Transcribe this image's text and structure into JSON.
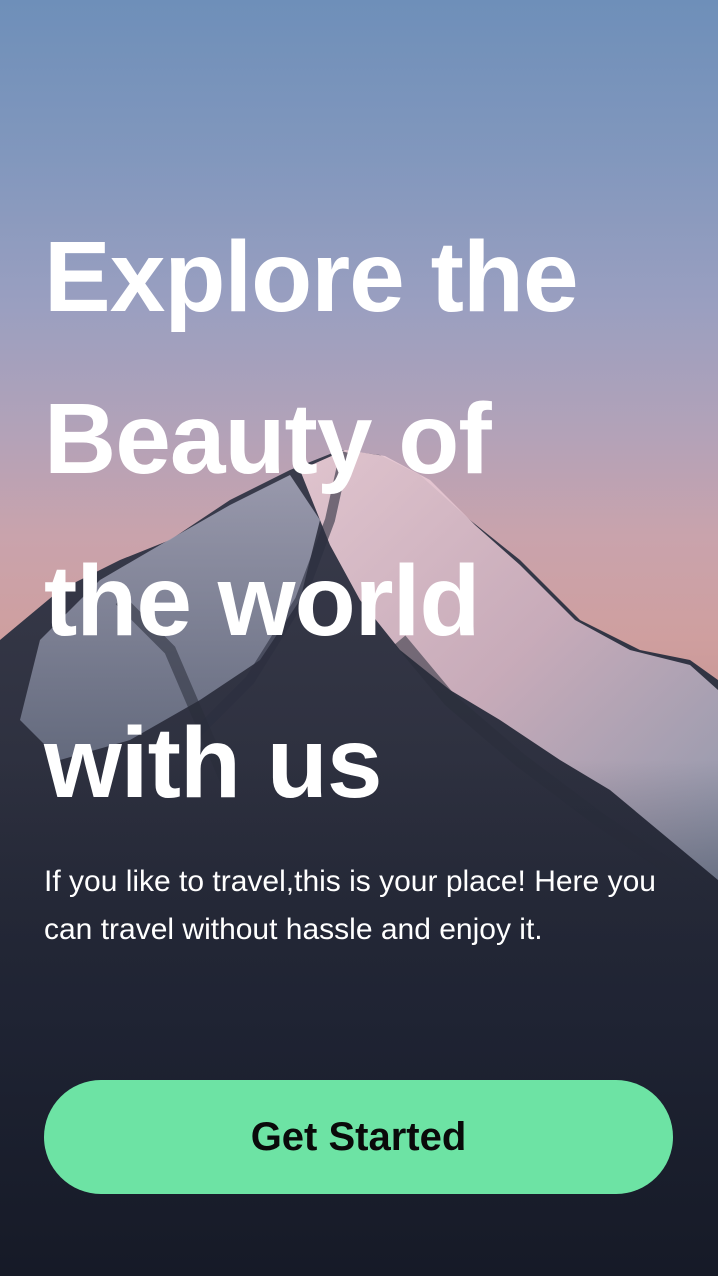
{
  "onboarding": {
    "headline_lines": [
      "Explore the",
      "Beauty of",
      "the world",
      "with us"
    ],
    "subtitle": "If you like to travel,this is your place! Here you can travel without hassle and enjoy it.",
    "cta_label": "Get Started"
  },
  "colors": {
    "cta_background": "#6de3a4",
    "cta_text": "#0a0a0a",
    "text": "#ffffff"
  },
  "background": {
    "image": "snow-capped-mountain-peak-at-dusk"
  }
}
